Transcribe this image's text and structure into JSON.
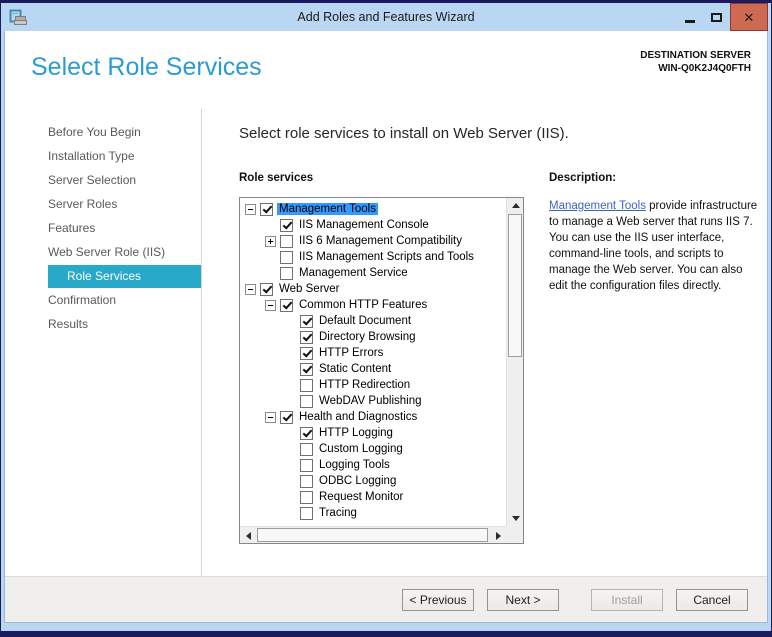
{
  "window": {
    "title": "Add Roles and Features Wizard",
    "controls": [
      "minimize",
      "maximize",
      "close"
    ]
  },
  "header": {
    "title": "Select Role Services",
    "destination_label": "DESTINATION SERVER",
    "destination_server": "WIN-Q0K2J4Q0FTH"
  },
  "sidebar": {
    "items": [
      {
        "label": "Before You Begin",
        "selected": false,
        "indent": 0
      },
      {
        "label": "Installation Type",
        "selected": false,
        "indent": 0
      },
      {
        "label": "Server Selection",
        "selected": false,
        "indent": 0
      },
      {
        "label": "Server Roles",
        "selected": false,
        "indent": 0
      },
      {
        "label": "Features",
        "selected": false,
        "indent": 0
      },
      {
        "label": "Web Server Role (IIS)",
        "selected": false,
        "indent": 0
      },
      {
        "label": "Role Services",
        "selected": true,
        "indent": 1
      },
      {
        "label": "Confirmation",
        "selected": false,
        "indent": 0
      },
      {
        "label": "Results",
        "selected": false,
        "indent": 0
      }
    ]
  },
  "main": {
    "instruction": "Select role services to install on Web Server (IIS).",
    "tree_label": "Role services",
    "tree": {
      "items": [
        {
          "label": "Management Tools",
          "level": 0,
          "expander": "minus",
          "checked": true,
          "selected": true
        },
        {
          "label": "IIS Management Console",
          "level": 1,
          "expander": null,
          "checked": true,
          "selected": false
        },
        {
          "label": "IIS 6 Management Compatibility",
          "level": 1,
          "expander": "plus",
          "checked": false,
          "selected": false
        },
        {
          "label": "IIS Management Scripts and Tools",
          "level": 1,
          "expander": null,
          "checked": false,
          "selected": false
        },
        {
          "label": "Management Service",
          "level": 1,
          "expander": null,
          "checked": false,
          "selected": false
        },
        {
          "label": "Web Server",
          "level": 0,
          "expander": "minus",
          "checked": true,
          "selected": false
        },
        {
          "label": "Common HTTP Features",
          "level": 1,
          "expander": "minus",
          "checked": true,
          "selected": false
        },
        {
          "label": "Default Document",
          "level": 2,
          "expander": null,
          "checked": true,
          "selected": false
        },
        {
          "label": "Directory Browsing",
          "level": 2,
          "expander": null,
          "checked": true,
          "selected": false
        },
        {
          "label": "HTTP Errors",
          "level": 2,
          "expander": null,
          "checked": true,
          "selected": false
        },
        {
          "label": "Static Content",
          "level": 2,
          "expander": null,
          "checked": true,
          "selected": false
        },
        {
          "label": "HTTP Redirection",
          "level": 2,
          "expander": null,
          "checked": false,
          "selected": false
        },
        {
          "label": "WebDAV Publishing",
          "level": 2,
          "expander": null,
          "checked": false,
          "selected": false
        },
        {
          "label": "Health and Diagnostics",
          "level": 1,
          "expander": "minus",
          "checked": true,
          "selected": false
        },
        {
          "label": "HTTP Logging",
          "level": 2,
          "expander": null,
          "checked": true,
          "selected": false
        },
        {
          "label": "Custom Logging",
          "level": 2,
          "expander": null,
          "checked": false,
          "selected": false
        },
        {
          "label": "Logging Tools",
          "level": 2,
          "expander": null,
          "checked": false,
          "selected": false
        },
        {
          "label": "ODBC Logging",
          "level": 2,
          "expander": null,
          "checked": false,
          "selected": false
        },
        {
          "label": "Request Monitor",
          "level": 2,
          "expander": null,
          "checked": false,
          "selected": false
        },
        {
          "label": "Tracing",
          "level": 2,
          "expander": null,
          "checked": false,
          "selected": false
        }
      ]
    },
    "description": {
      "label": "Description:",
      "link_text": "Management Tools",
      "text": " provide infrastructure to manage a Web server that runs IIS 7. You can use the IIS user interface, command-line tools, and scripts to manage the Web server. You can also edit the configuration files directly."
    }
  },
  "footer": {
    "buttons": [
      {
        "label": "< Previous",
        "enabled": true
      },
      {
        "label": "Next >",
        "enabled": true
      },
      {
        "label": "Install",
        "enabled": false
      },
      {
        "label": "Cancel",
        "enabled": true
      }
    ]
  },
  "colors": {
    "titlebar-blue": "#B9D7F2",
    "frame-navy": "#1B1B5E",
    "header-blue": "#2D9BD3",
    "nav-selected-bg": "#28A9C9",
    "tree-selection-bg": "#3399FF",
    "close-button-bg": "#CE6A52",
    "link-color": "#3F63C8",
    "footer-bg": "#F1EFEE"
  }
}
